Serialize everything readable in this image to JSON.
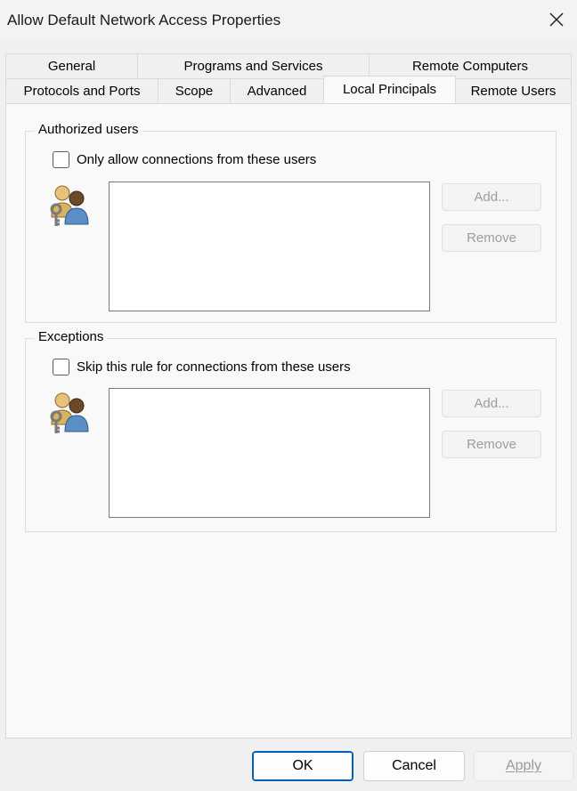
{
  "window": {
    "title": "Allow Default Network Access Properties"
  },
  "tabs": {
    "row1": [
      "General",
      "Programs and Services",
      "Remote Computers"
    ],
    "row2": [
      "Protocols and Ports",
      "Scope",
      "Advanced",
      "Local Principals",
      "Remote Users"
    ],
    "active": "Local Principals"
  },
  "authorized": {
    "group_label": "Authorized users",
    "checkbox_label": "Only allow connections from these users",
    "checked": false,
    "add_label": "Add...",
    "remove_label": "Remove",
    "icon": "users-key-icon"
  },
  "exceptions": {
    "group_label": "Exceptions",
    "checkbox_label": "Skip this rule for connections from these users",
    "checked": false,
    "add_label": "Add...",
    "remove_label": "Remove",
    "icon": "users-key-icon"
  },
  "footer": {
    "ok_label": "OK",
    "cancel_label": "Cancel",
    "apply_label": "Apply"
  },
  "colors": {
    "accent": "#005fb8",
    "disabled_text": "#9d9d9d"
  }
}
